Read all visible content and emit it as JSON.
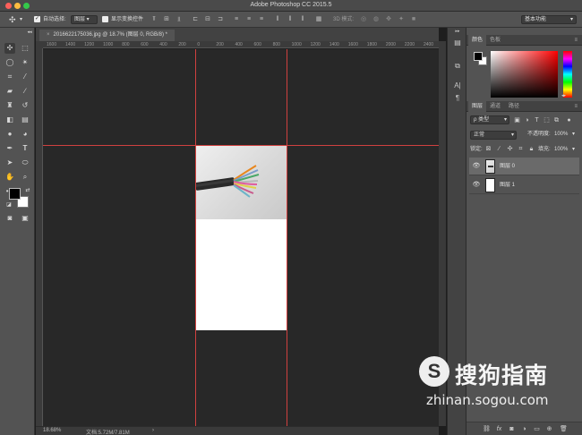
{
  "window": {
    "title": "Adobe Photoshop CC 2015.5",
    "colors": {
      "close": "#fc605b",
      "minimize": "#fdbc40",
      "zoom": "#34c84a"
    }
  },
  "options": {
    "auto_select_label": "自动选择:",
    "auto_select_target": "图层",
    "show_transform_label": "显示变换控件",
    "mode_3d_label": "3D 模式:",
    "workspace": "基本功能"
  },
  "document": {
    "tab_title": "20166221750​36.jpg @ 18.7% (图层 0, RGB/8) *",
    "close_glyph": "×",
    "ruler_labels": [
      "1600",
      "1400",
      "1200",
      "1000",
      "800",
      "600",
      "400",
      "200",
      "0",
      "200",
      "400",
      "600",
      "800",
      "1000",
      "1200",
      "1400",
      "1600",
      "1800",
      "2000",
      "2200",
      "2400"
    ],
    "guide_color": "#d0413f"
  },
  "status": {
    "zoom": "18.68%",
    "doc_info": "文档:5.72M/7.81M",
    "arrow": "›"
  },
  "color_panel": {
    "tabs": [
      "颜色",
      "色板"
    ],
    "hue_color": "#ff0000"
  },
  "layers_panel": {
    "tabs": [
      "图层",
      "通道",
      "路径"
    ],
    "filter_label": "ρ 类型",
    "blend_mode": "正常",
    "opacity_label": "不透明度:",
    "opacity_value": "100%",
    "lock_label": "锁定:",
    "fill_label": "填充:",
    "fill_value": "100%",
    "layers": [
      {
        "name": "图层 0",
        "visible": true,
        "selected": true
      },
      {
        "name": "图层 1",
        "visible": true,
        "selected": false
      }
    ],
    "bottom_icons": [
      "link-icon",
      "fx-icon",
      "mask-icon",
      "adjustment-icon",
      "folder-icon",
      "new-layer-icon",
      "trash-icon"
    ]
  },
  "watermark": {
    "logo_glyph": "S",
    "text": "搜狗指南",
    "url": "zhinan.sogou.com"
  }
}
